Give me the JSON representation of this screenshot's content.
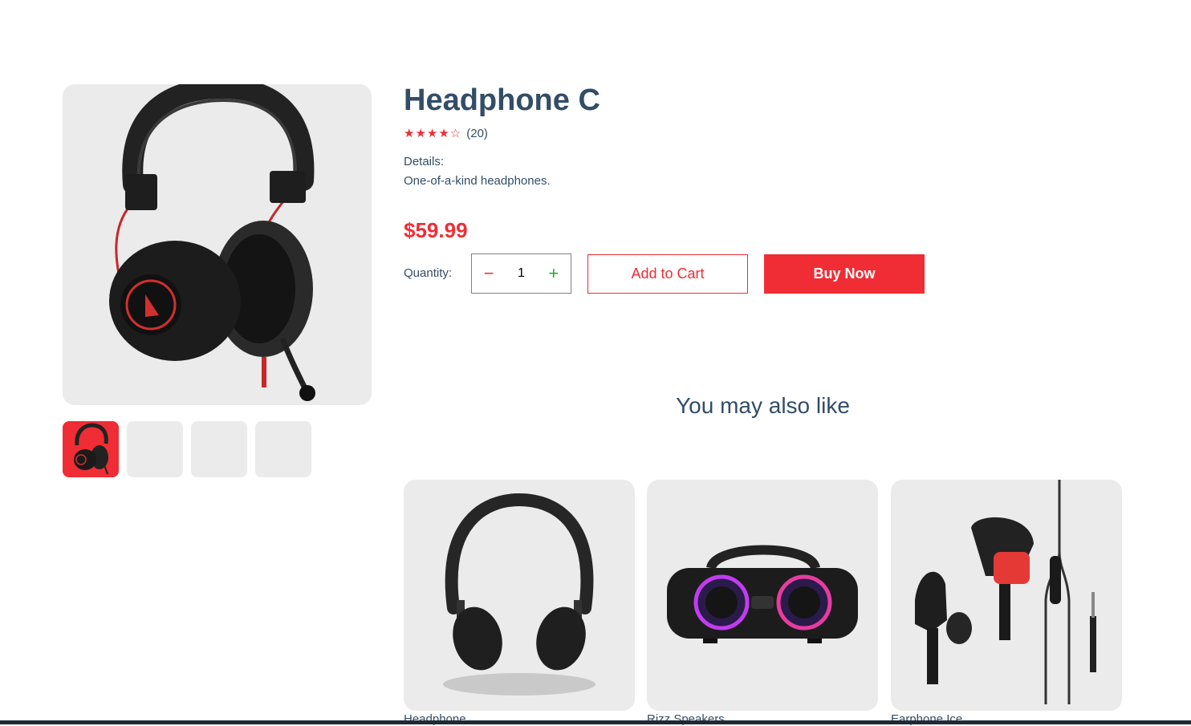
{
  "product": {
    "title": "Headphone C",
    "rating_stars": "★★★★☆",
    "rating_count": "(20)",
    "details_heading": "Details:",
    "details_text": "One-of-a-kind headphones.",
    "price": "$59.99",
    "quantity_label": "Quantity:",
    "quantity_value": "1",
    "minus_symbol": "−",
    "plus_symbol": "+",
    "add_to_cart_label": "Add to Cart",
    "buy_now_label": "Buy Now",
    "main_image_icon": "over-ear-headphone-with-mic-image",
    "thumbnails": [
      {
        "icon": "headphone-thumbnail",
        "active": true
      },
      {
        "icon": "empty-thumbnail",
        "active": false
      },
      {
        "icon": "empty-thumbnail",
        "active": false
      },
      {
        "icon": "empty-thumbnail",
        "active": false
      }
    ]
  },
  "recommendations": {
    "heading": "You may also like",
    "items": [
      {
        "name": "Headphone",
        "icon": "headphone-image"
      },
      {
        "name": "Rizz Speakers",
        "icon": "speaker-image"
      },
      {
        "name": "Earphone Ice",
        "icon": "earphone-image"
      }
    ]
  },
  "colors": {
    "accent": "#f02d34",
    "text": "#324d67",
    "card_bg": "#ebebeb",
    "plus": "#31a831"
  }
}
